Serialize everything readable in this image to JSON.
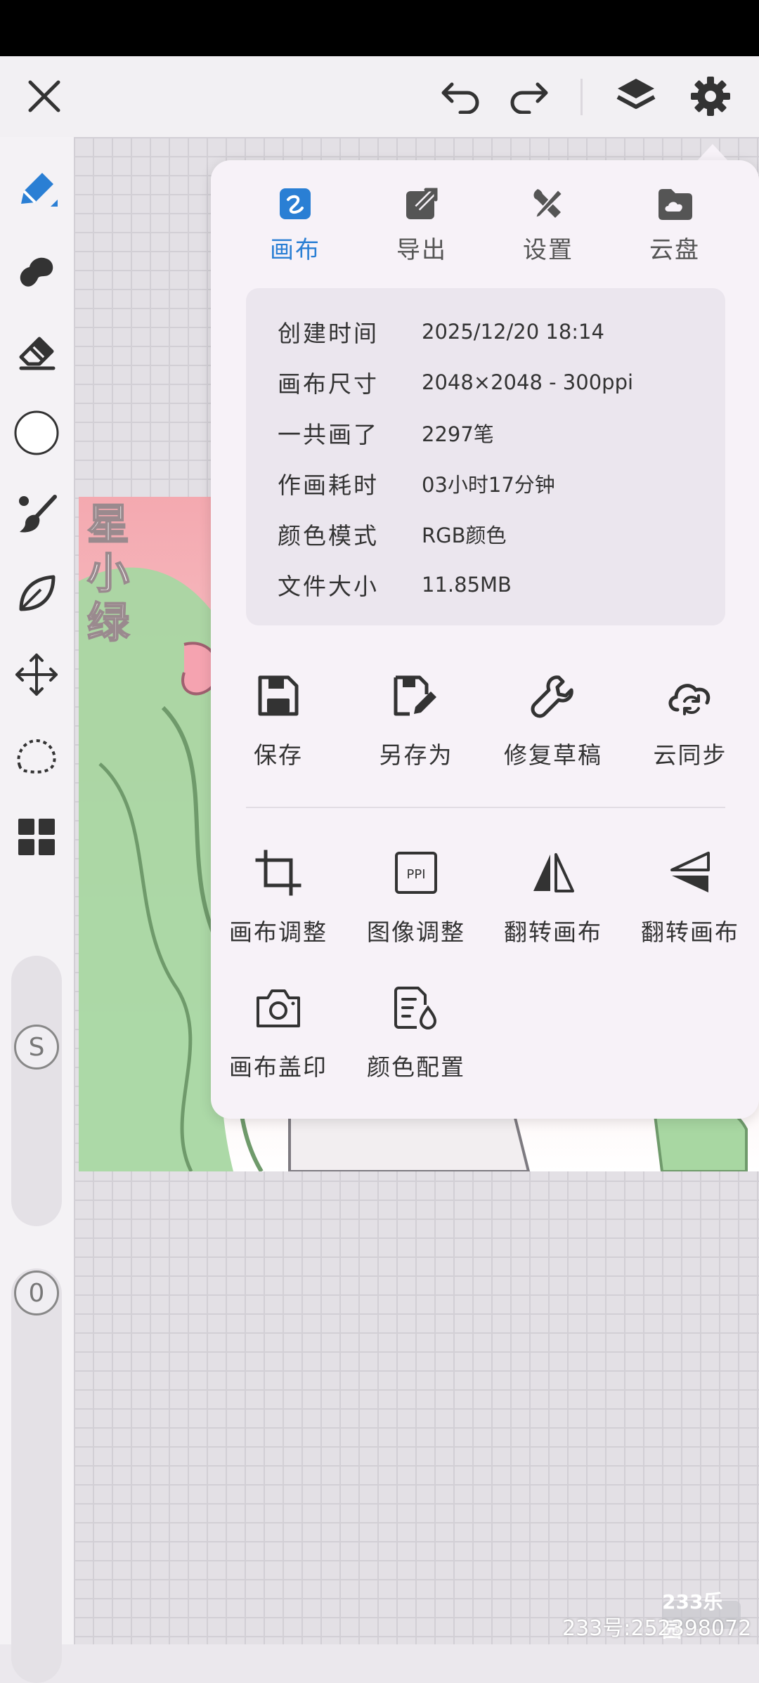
{
  "popover": {
    "tabs": [
      {
        "label": "画布",
        "icon": "canvas-icon",
        "active": true
      },
      {
        "label": "导出",
        "icon": "export-icon"
      },
      {
        "label": "设置",
        "icon": "settings-tools-icon"
      },
      {
        "label": "云盘",
        "icon": "cloud-drive-icon"
      }
    ],
    "info": [
      {
        "key": "创建时间",
        "value": "2025/12/20 18:14"
      },
      {
        "key": "画布尺寸",
        "value": "2048×2048 - 300ppi"
      },
      {
        "key": "一共画了",
        "value": "2297笔"
      },
      {
        "key": "作画耗时",
        "value": "03小时17分钟"
      },
      {
        "key": "颜色模式",
        "value": "RGB颜色"
      },
      {
        "key": "文件大小",
        "value": "11.85MB"
      }
    ],
    "actions_row1": [
      {
        "label": "保存",
        "icon": "save-icon"
      },
      {
        "label": "另存为",
        "icon": "save-as-icon"
      },
      {
        "label": "修复草稿",
        "icon": "repair-icon"
      },
      {
        "label": "云同步",
        "icon": "cloud-sync-icon"
      }
    ],
    "actions_row2": [
      {
        "label": "画布调整",
        "icon": "crop-icon"
      },
      {
        "label": "图像调整",
        "icon": "ppi-icon",
        "icon_text": "PPI"
      },
      {
        "label": "翻转画布",
        "icon": "flip-horizontal-icon"
      },
      {
        "label": "翻转画布",
        "icon": "flip-vertical-icon"
      }
    ],
    "actions_row3": [
      {
        "label": "画布盖印",
        "icon": "camera-icon"
      },
      {
        "label": "颜色配置",
        "icon": "color-profile-icon"
      }
    ]
  },
  "sliders": {
    "size_badge": "S",
    "opacity_badge": "0"
  },
  "watermark": {
    "logo": "233乐园",
    "id_text": "233号:252398072"
  },
  "colors": {
    "accent": "#2a7fd4",
    "popover_bg": "#f7f2f8",
    "info_bg": "#ebe6ee"
  }
}
